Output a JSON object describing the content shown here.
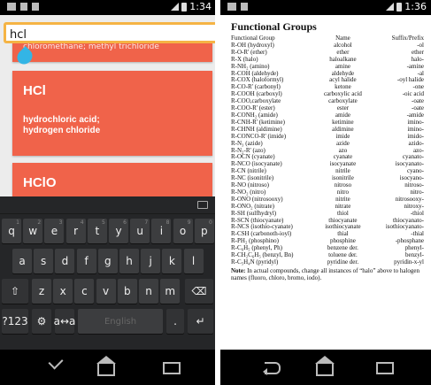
{
  "left": {
    "status_time": "1:34",
    "search": {
      "value": "hcl",
      "placeholder": ""
    },
    "cards": [
      {
        "snippet": "chloromethane; methyl trichloride"
      },
      {
        "formula": "HCl",
        "names": "hydrochloric acid;\nhydrogen chloride"
      },
      {
        "formula": "HClO"
      }
    ],
    "keyboard": {
      "row1": [
        "q",
        "w",
        "e",
        "r",
        "t",
        "y",
        "u",
        "i",
        "o",
        "p"
      ],
      "row1_sub": [
        "1",
        "2",
        "3",
        "4",
        "5",
        "6",
        "7",
        "8",
        "9",
        "0"
      ],
      "row2": [
        "a",
        "s",
        "d",
        "f",
        "g",
        "h",
        "j",
        "k",
        "l"
      ],
      "row3": [
        "z",
        "x",
        "c",
        "v",
        "b",
        "n",
        "m"
      ],
      "shift_label": "⇧",
      "delete_label": "⌫",
      "numbers_label": "?123",
      "settings_label": "⚙",
      "lang_label": "a↔a",
      "space_label": "English",
      "period_label": ".",
      "enter_label": "↵"
    }
  },
  "right": {
    "status_time": "1:36",
    "title": "Functional Groups",
    "headers": [
      "Functional Group",
      "Name",
      "Suffix/Prefix"
    ],
    "rows": [
      [
        "R-OH (hydroxyl)",
        "alcohol",
        "-ol"
      ],
      [
        "R-O-R' (ether)",
        "ether",
        "ether"
      ],
      [
        "R-X (halo)",
        "haloalkane",
        "halo-"
      ],
      [
        "R-NH₂ (amino)",
        "amine",
        "-amine"
      ],
      [
        "R-COH (aldehyde)",
        "aldehyde",
        "-al"
      ],
      [
        "R-COX (haloformyl)",
        "acyl halide",
        "-oyl halide"
      ],
      [
        "R-CO-R' (carbonyl)",
        "ketone",
        "-one"
      ],
      [
        "R-COOH (carboxyl)",
        "carboxylic acid",
        "-oic acid"
      ],
      [
        "R-COO,carboxylate",
        "carboxylate",
        "-oate"
      ],
      [
        "R-COO-R' (ester)",
        "ester",
        "-oate"
      ],
      [
        "R-CONH₂ (amide)",
        "amide",
        "-amide"
      ],
      [
        "R-CNH-R' (ketimine)",
        "ketimine",
        "imino-"
      ],
      [
        "R-CHNH (aldimine)",
        "aldimine",
        "imino-"
      ],
      [
        "R-CONCO-R' (imide)",
        "imide",
        "imido-"
      ],
      [
        "R-N₃ (azide)",
        "azide",
        "azido-"
      ],
      [
        "R-N₂-R' (azo)",
        "azo",
        "azo-"
      ],
      [
        "R-OCN (cyanate)",
        "cyanate",
        "cyanato-"
      ],
      [
        "R-NCO (isocyanate)",
        "isocyanate",
        "isocyanato-"
      ],
      [
        "R-CN (nitrile)",
        "nitrile",
        "cyano-"
      ],
      [
        "R-NC (isonitrile)",
        "isonitrile",
        "isocyano-"
      ],
      [
        "R-NO (nitroso)",
        "nitroso",
        "nitroso-"
      ],
      [
        "R-NO₂ (nitro)",
        "nitro",
        "nitro-"
      ],
      [
        "R-ONO (nitrosooxy)",
        "nitrite",
        "nitrosooxy-"
      ],
      [
        "R-ONO₂ (nitrate)",
        "nitrate",
        "nitroxy-"
      ],
      [
        "R-SH (sulfhydryl)",
        "thiol",
        "-thiol"
      ],
      [
        "R-SCN (thiocyanate)",
        "thiocyanate",
        "thiocyanato-"
      ],
      [
        "R-NCS (isothio-cyanate)",
        "isothiocyanate",
        "isothiocyanato-"
      ],
      [
        "R-CSH (carbonoth-ioyl)",
        "thial",
        "-thial"
      ],
      [
        "R-PH₂ (phosphino)",
        "phosphine",
        "-phosphane"
      ],
      [
        "R-C₆H₅ (phenyl, Ph)",
        "benzene der.",
        "phenyl-"
      ],
      [
        "R-CH₂C₆H₅ (benzyl, Bn)",
        "toluene der.",
        "benzyl-"
      ],
      [
        "R-C₅H₄N (pyridyl)",
        "pyridine der.",
        "pyridin-x-yl"
      ]
    ],
    "note_label": "Note:",
    "note_text": "In actual compounds, change all instances of “halo” above to halogen names (fluoro, chloro, bromo, iodo)."
  },
  "colors": {
    "card": "#f0634a",
    "search_border": "#f5b445",
    "cursor": "#33b5e5"
  }
}
